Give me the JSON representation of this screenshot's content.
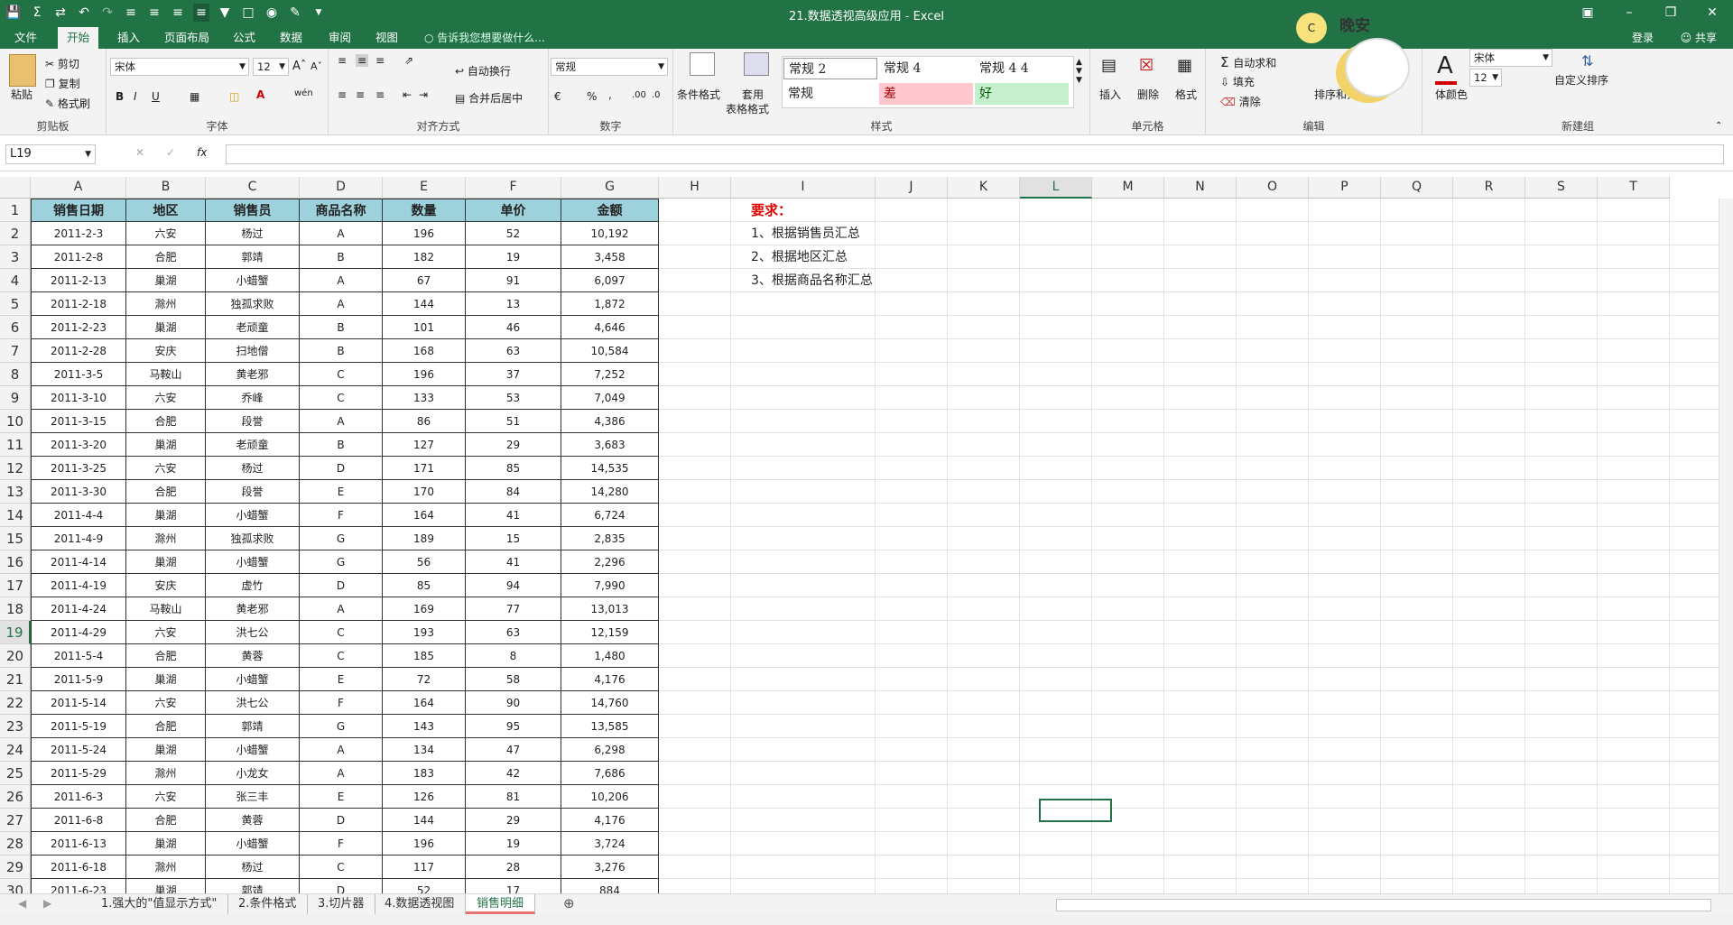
{
  "window": {
    "title": "21.数据透视高级应用 - Excel"
  },
  "ribbon_tabs": [
    "文件",
    "开始",
    "插入",
    "页面布局",
    "公式",
    "数据",
    "审阅",
    "视图"
  ],
  "tell_me": "告诉我您想要做什么...",
  "account": {
    "signin": "登录",
    "share": "共享"
  },
  "clipboard": {
    "paste": "粘贴",
    "cut": "剪切",
    "copy": "复制",
    "format_painter": "格式刷",
    "label": "剪贴板"
  },
  "font": {
    "name": "宋体",
    "size": "12",
    "label": "字体",
    "b": "B",
    "i": "I",
    "u": "U"
  },
  "alignment": {
    "wrap": "自动换行",
    "merge": "合并后居中",
    "label": "对齐方式"
  },
  "number": {
    "format": "常规",
    "label": "数字",
    "percent": "%",
    "comma": ","
  },
  "styles": {
    "cond": "条件格式",
    "table": "套用",
    "table2": "表格格式",
    "items": [
      "常规 2",
      "常规 4",
      "常规 4 4",
      "常规",
      "差",
      "好"
    ],
    "label": "样式"
  },
  "cells": {
    "insert": "插入",
    "delete": "删除",
    "format": "格式",
    "label": "单元格"
  },
  "editing": {
    "autosum": "自动求和",
    "fill": "填充",
    "clear": "清除",
    "sort": "排序和筛选",
    "label": "编辑"
  },
  "newgroup": {
    "font_color": "体颜色",
    "font": "宋体",
    "size": "12",
    "custom_sort": "自定义排序",
    "label": "新建组"
  },
  "sticker": {
    "text": "晚安",
    "moon": "C"
  },
  "namebox": "L19",
  "fx": "fx",
  "columns": [
    "A",
    "B",
    "C",
    "D",
    "E",
    "F",
    "G",
    "H",
    "I",
    "J",
    "K",
    "L",
    "M",
    "N",
    "O",
    "P",
    "Q",
    "R",
    "S",
    "T"
  ],
  "selected_col": "L",
  "selected_row": "19",
  "headers": [
    "销售日期",
    "地区",
    "销售员",
    "商品名称",
    "数量",
    "单价",
    "金额"
  ],
  "rows": [
    [
      "2011-2-3",
      "六安",
      "杨过",
      "A",
      "196",
      "52",
      "10,192"
    ],
    [
      "2011-2-8",
      "合肥",
      "郭靖",
      "B",
      "182",
      "19",
      "3,458"
    ],
    [
      "2011-2-13",
      "巢湖",
      "小蜡蟹",
      "A",
      "67",
      "91",
      "6,097"
    ],
    [
      "2011-2-18",
      "滁州",
      "独孤求败",
      "A",
      "144",
      "13",
      "1,872"
    ],
    [
      "2011-2-23",
      "巢湖",
      "老顽童",
      "B",
      "101",
      "46",
      "4,646"
    ],
    [
      "2011-2-28",
      "安庆",
      "扫地僧",
      "B",
      "168",
      "63",
      "10,584"
    ],
    [
      "2011-3-5",
      "马鞍山",
      "黄老邪",
      "C",
      "196",
      "37",
      "7,252"
    ],
    [
      "2011-3-10",
      "六安",
      "乔峰",
      "C",
      "133",
      "53",
      "7,049"
    ],
    [
      "2011-3-15",
      "合肥",
      "段誉",
      "A",
      "86",
      "51",
      "4,386"
    ],
    [
      "2011-3-20",
      "巢湖",
      "老顽童",
      "B",
      "127",
      "29",
      "3,683"
    ],
    [
      "2011-3-25",
      "六安",
      "杨过",
      "D",
      "171",
      "85",
      "14,535"
    ],
    [
      "2011-3-30",
      "合肥",
      "段誉",
      "E",
      "170",
      "84",
      "14,280"
    ],
    [
      "2011-4-4",
      "巢湖",
      "小蜡蟹",
      "F",
      "164",
      "41",
      "6,724"
    ],
    [
      "2011-4-9",
      "滁州",
      "独孤求败",
      "G",
      "189",
      "15",
      "2,835"
    ],
    [
      "2011-4-14",
      "巢湖",
      "小蜡蟹",
      "G",
      "56",
      "41",
      "2,296"
    ],
    [
      "2011-4-19",
      "安庆",
      "虚竹",
      "D",
      "85",
      "94",
      "7,990"
    ],
    [
      "2011-4-24",
      "马鞍山",
      "黄老邪",
      "A",
      "169",
      "77",
      "13,013"
    ],
    [
      "2011-4-29",
      "六安",
      "洪七公",
      "C",
      "193",
      "63",
      "12,159"
    ],
    [
      "2011-5-4",
      "合肥",
      "黄蓉",
      "C",
      "185",
      "8",
      "1,480"
    ],
    [
      "2011-5-9",
      "巢湖",
      "小蜡蟹",
      "E",
      "72",
      "58",
      "4,176"
    ],
    [
      "2011-5-14",
      "六安",
      "洪七公",
      "F",
      "164",
      "90",
      "14,760"
    ],
    [
      "2011-5-19",
      "合肥",
      "郭靖",
      "G",
      "143",
      "95",
      "13,585"
    ],
    [
      "2011-5-24",
      "巢湖",
      "小蜡蟹",
      "A",
      "134",
      "47",
      "6,298"
    ],
    [
      "2011-5-29",
      "滁州",
      "小龙女",
      "A",
      "183",
      "42",
      "7,686"
    ],
    [
      "2011-6-3",
      "六安",
      "张三丰",
      "E",
      "126",
      "81",
      "10,206"
    ],
    [
      "2011-6-8",
      "合肥",
      "黄蓉",
      "D",
      "144",
      "29",
      "4,176"
    ],
    [
      "2011-6-13",
      "巢湖",
      "小蜡蟹",
      "F",
      "196",
      "19",
      "3,724"
    ],
    [
      "2011-6-18",
      "滁州",
      "杨过",
      "C",
      "117",
      "28",
      "3,276"
    ],
    [
      "2011-6-23",
      "巢湖",
      "郭靖",
      "D",
      "52",
      "17",
      "884"
    ]
  ],
  "notes": {
    "title": "要求：",
    "items": [
      "1、根据销售员汇总",
      "2、根据地区汇总",
      "3、根据商品名称汇总"
    ]
  },
  "sheets": [
    "1.强大的\"值显示方式\"",
    "2.条件格式",
    "3.切片器",
    "4.数据透视图",
    "销售明细"
  ],
  "active_sheet": "销售明细",
  "colors": {
    "accent": "#217346",
    "header_fill": "#9dd1dc",
    "note_title": "#e00000",
    "bad_fill": "#ffc7ce",
    "good_fill": "#c6efce"
  }
}
